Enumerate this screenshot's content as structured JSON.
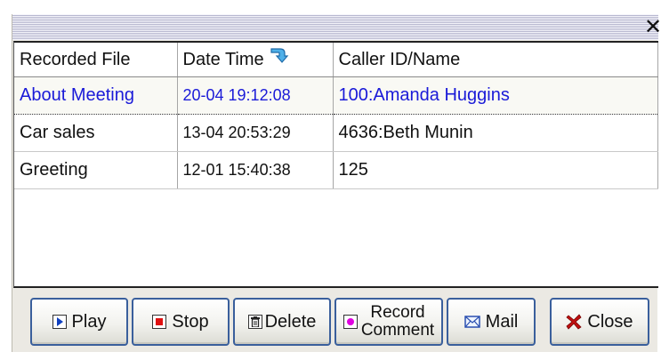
{
  "window": {
    "close_glyph": "✕"
  },
  "table": {
    "columns": [
      {
        "label": "Recorded File"
      },
      {
        "label": "Date Time"
      },
      {
        "label": "Caller ID/Name"
      }
    ],
    "sort_icon": "sort-descending-arrow-icon",
    "rows": [
      {
        "file": "About Meeting",
        "datetime": "20-04 19:12:08",
        "caller": "100:Amanda Huggins",
        "selected": true
      },
      {
        "file": "Car sales",
        "datetime": "13-04 20:53:29",
        "caller": "4636:Beth Munin",
        "selected": false
      },
      {
        "file": "Greeting",
        "datetime": "12-01 15:40:38",
        "caller": "125",
        "selected": false
      }
    ]
  },
  "buttons": {
    "play": {
      "label": "Play",
      "icon": "play-icon"
    },
    "stop": {
      "label": "Stop",
      "icon": "stop-icon"
    },
    "delete": {
      "label": "Delete",
      "icon": "trash-icon"
    },
    "record": {
      "label_line1": "Record",
      "label_line2": "Comment",
      "icon": "record-icon"
    },
    "mail": {
      "label": "Mail",
      "icon": "envelope-icon"
    },
    "close": {
      "label": "Close",
      "icon": "close-x-icon"
    }
  },
  "colors": {
    "selected_text": "#1a1ad8",
    "button_border": "#3a5f9c",
    "stop_red": "#e01010",
    "record_magenta": "#e000e0",
    "play_blue": "#1040c0"
  }
}
